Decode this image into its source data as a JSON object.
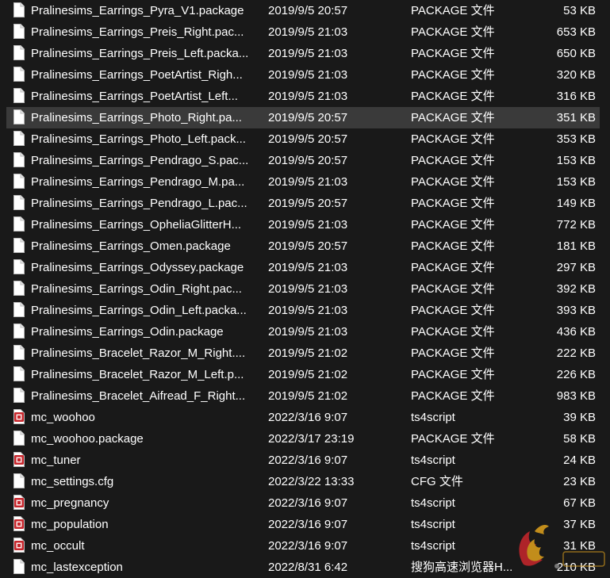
{
  "files": [
    {
      "name": "Pralinesims_Earrings_Pyra_V1.package",
      "date": "2019/9/5 20:57",
      "type": "PACKAGE 文件",
      "size": "53 KB",
      "icon": "package-file-icon"
    },
    {
      "name": "Pralinesims_Earrings_Preis_Right.pac...",
      "date": "2019/9/5 21:03",
      "type": "PACKAGE 文件",
      "size": "653 KB",
      "icon": "package-file-icon"
    },
    {
      "name": "Pralinesims_Earrings_Preis_Left.packa...",
      "date": "2019/9/5 21:03",
      "type": "PACKAGE 文件",
      "size": "650 KB",
      "icon": "package-file-icon"
    },
    {
      "name": "Pralinesims_Earrings_PoetArtist_Righ...",
      "date": "2019/9/5 21:03",
      "type": "PACKAGE 文件",
      "size": "320 KB",
      "icon": "package-file-icon"
    },
    {
      "name": "Pralinesims_Earrings_PoetArtist_Left...",
      "date": "2019/9/5 21:03",
      "type": "PACKAGE 文件",
      "size": "316 KB",
      "icon": "package-file-icon"
    },
    {
      "name": "Pralinesims_Earrings_Photo_Right.pa...",
      "date": "2019/9/5 20:57",
      "type": "PACKAGE 文件",
      "size": "351 KB",
      "icon": "package-file-icon",
      "selected": true
    },
    {
      "name": "Pralinesims_Earrings_Photo_Left.pack...",
      "date": "2019/9/5 20:57",
      "type": "PACKAGE 文件",
      "size": "353 KB",
      "icon": "package-file-icon"
    },
    {
      "name": "Pralinesims_Earrings_Pendrago_S.pac...",
      "date": "2019/9/5 20:57",
      "type": "PACKAGE 文件",
      "size": "153 KB",
      "icon": "package-file-icon"
    },
    {
      "name": "Pralinesims_Earrings_Pendrago_M.pa...",
      "date": "2019/9/5 21:03",
      "type": "PACKAGE 文件",
      "size": "153 KB",
      "icon": "package-file-icon"
    },
    {
      "name": "Pralinesims_Earrings_Pendrago_L.pac...",
      "date": "2019/9/5 20:57",
      "type": "PACKAGE 文件",
      "size": "149 KB",
      "icon": "package-file-icon"
    },
    {
      "name": "Pralinesims_Earrings_OpheliaGlitterH...",
      "date": "2019/9/5 21:03",
      "type": "PACKAGE 文件",
      "size": "772 KB",
      "icon": "package-file-icon"
    },
    {
      "name": "Pralinesims_Earrings_Omen.package",
      "date": "2019/9/5 20:57",
      "type": "PACKAGE 文件",
      "size": "181 KB",
      "icon": "package-file-icon"
    },
    {
      "name": "Pralinesims_Earrings_Odyssey.package",
      "date": "2019/9/5 21:03",
      "type": "PACKAGE 文件",
      "size": "297 KB",
      "icon": "package-file-icon"
    },
    {
      "name": "Pralinesims_Earrings_Odin_Right.pac...",
      "date": "2019/9/5 21:03",
      "type": "PACKAGE 文件",
      "size": "392 KB",
      "icon": "package-file-icon"
    },
    {
      "name": "Pralinesims_Earrings_Odin_Left.packa...",
      "date": "2019/9/5 21:03",
      "type": "PACKAGE 文件",
      "size": "393 KB",
      "icon": "package-file-icon"
    },
    {
      "name": "Pralinesims_Earrings_Odin.package",
      "date": "2019/9/5 21:03",
      "type": "PACKAGE 文件",
      "size": "436 KB",
      "icon": "package-file-icon"
    },
    {
      "name": "Pralinesims_Bracelet_Razor_M_Right....",
      "date": "2019/9/5 21:02",
      "type": "PACKAGE 文件",
      "size": "222 KB",
      "icon": "package-file-icon"
    },
    {
      "name": "Pralinesims_Bracelet_Razor_M_Left.p...",
      "date": "2019/9/5 21:02",
      "type": "PACKAGE 文件",
      "size": "226 KB",
      "icon": "package-file-icon"
    },
    {
      "name": "Pralinesims_Bracelet_Aifread_F_Right...",
      "date": "2019/9/5 21:02",
      "type": "PACKAGE 文件",
      "size": "983 KB",
      "icon": "package-file-icon"
    },
    {
      "name": "mc_woohoo",
      "date": "2022/3/16 9:07",
      "type": "ts4script",
      "size": "39 KB",
      "icon": "ts4script-file-icon"
    },
    {
      "name": "mc_woohoo.package",
      "date": "2022/3/17 23:19",
      "type": "PACKAGE 文件",
      "size": "58 KB",
      "icon": "package-file-icon"
    },
    {
      "name": "mc_tuner",
      "date": "2022/3/16 9:07",
      "type": "ts4script",
      "size": "24 KB",
      "icon": "ts4script-file-icon"
    },
    {
      "name": "mc_settings.cfg",
      "date": "2022/3/22 13:33",
      "type": "CFG 文件",
      "size": "23 KB",
      "icon": "cfg-file-icon"
    },
    {
      "name": "mc_pregnancy",
      "date": "2022/3/16 9:07",
      "type": "ts4script",
      "size": "67 KB",
      "icon": "ts4script-file-icon"
    },
    {
      "name": "mc_population",
      "date": "2022/3/16 9:07",
      "type": "ts4script",
      "size": "37 KB",
      "icon": "ts4script-file-icon"
    },
    {
      "name": "mc_occult",
      "date": "2022/3/16 9:07",
      "type": "ts4script",
      "size": "31 KB",
      "icon": "ts4script-file-icon"
    },
    {
      "name": "mc_lastexception",
      "date": "2022/8/31 6:42",
      "type": "搜狗高速浏览器H...",
      "size": "210 KB",
      "icon": "html-file-icon"
    }
  ],
  "colors": {
    "background": "#191919",
    "selected_row": "#3a3a3a",
    "text": "#ffffff",
    "script_icon": "#c8262c"
  }
}
